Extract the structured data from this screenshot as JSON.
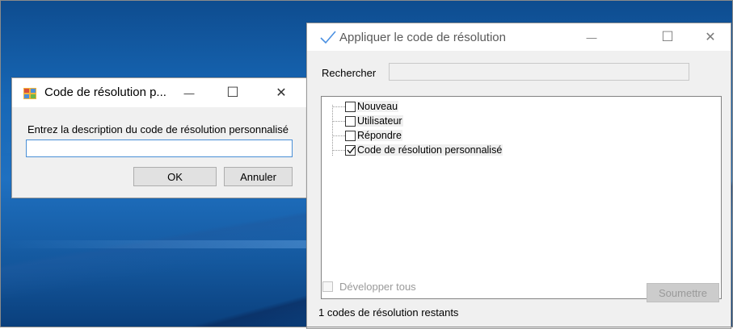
{
  "colors": {
    "desktop_blue": "#1767b5",
    "window_bg": "#f0f0f0",
    "input_focus_border": "#4a8fd6",
    "check_logo": "#4a90e2",
    "disabled_text": "#9a9a9a"
  },
  "dialog": {
    "title": "Code de résolution p...",
    "icon": "app-window-icon",
    "prompt": "Entrez la description du code de résolution personnalisé",
    "input_value": "",
    "ok_label": "OK",
    "cancel_label": "Annuler",
    "minimize_glyph": "—",
    "maximize_glyph": "☐",
    "close_glyph": "✕"
  },
  "main": {
    "title": "Appliquer le code de résolution",
    "icon": "checkmark-icon",
    "minimize_glyph": "—",
    "maximize_glyph": "☐",
    "close_glyph": "✕",
    "search_label": "Rechercher",
    "search_value": "",
    "tree_items": [
      {
        "label": "Nouveau",
        "checked": false
      },
      {
        "label": "Utilisateur",
        "checked": false
      },
      {
        "label": "Répondre",
        "checked": false
      },
      {
        "label": "Code de résolution personnalisé",
        "checked": true
      }
    ],
    "expand_all_label": "Développer tous",
    "expand_all_checked": false,
    "submit_label": "Soumettre",
    "status_text": "1 codes  de résolution restants"
  }
}
